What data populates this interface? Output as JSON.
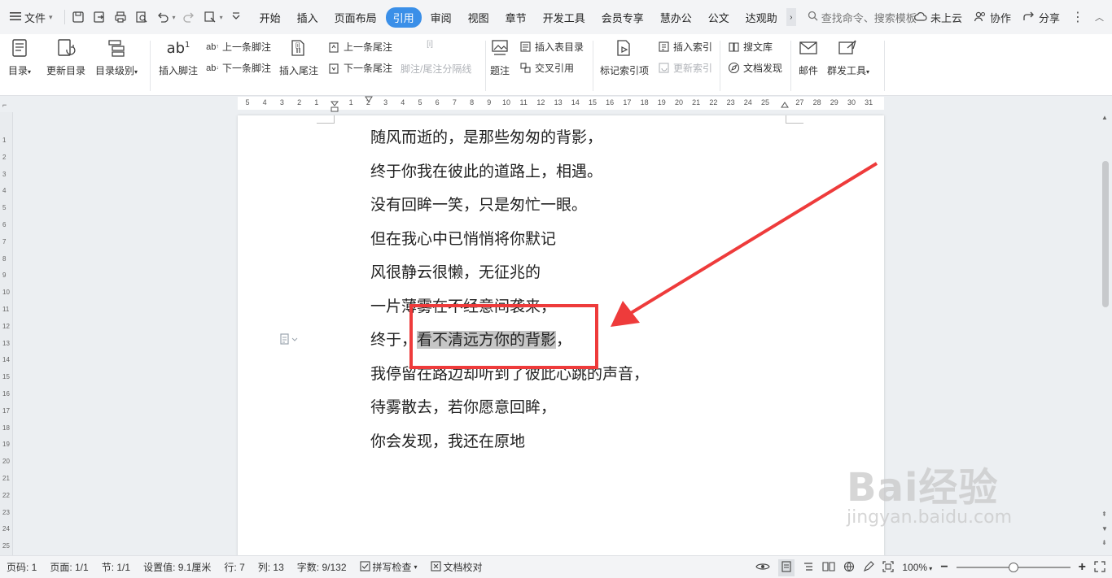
{
  "menubar": {
    "file_label": "文件",
    "tabs": [
      "开始",
      "插入",
      "页面布局",
      "引用",
      "审阅",
      "视图",
      "章节",
      "开发工具",
      "会员专享",
      "慧办公",
      "公文",
      "达观助"
    ],
    "active_tab": "引用",
    "search_placeholder": "查找命令、搜索模板",
    "right": {
      "cloud": "未上云",
      "collab": "协作",
      "share": "分享"
    }
  },
  "ribbon": {
    "toc": "目录",
    "update_toc": "更新目录",
    "toc_level": "目录级别",
    "insert_footnote": "插入脚注",
    "prev_footnote": "上一条脚注",
    "next_footnote": "下一条脚注",
    "insert_endnote": "插入尾注",
    "prev_endnote": "上一条尾注",
    "next_endnote": "下一条尾注",
    "note_separator": "脚注/尾注分隔线",
    "caption": "题注",
    "insert_table_toc": "插入表目录",
    "cross_ref": "交叉引用",
    "mark_index": "标记索引项",
    "insert_index": "插入索引",
    "update_index": "更新索引",
    "search_library": "搜文库",
    "doc_discover": "文档发现",
    "mail": "邮件",
    "mass_tool": "群发工具"
  },
  "ruler_numbers": [
    "5",
    "4",
    "3",
    "2",
    "1",
    "",
    "1",
    "2",
    "3",
    "4",
    "5",
    "6",
    "7",
    "8",
    "9",
    "10",
    "11",
    "12",
    "13",
    "14",
    "15",
    "16",
    "17",
    "18",
    "19",
    "20",
    "21",
    "22",
    "23",
    "24",
    "25",
    "",
    "27",
    "28",
    "29",
    "30",
    "31"
  ],
  "vruler_numbers": [
    "1",
    "2",
    "3",
    "4",
    "5",
    "6",
    "7",
    "8",
    "9",
    "10",
    "11",
    "12",
    "13",
    "14",
    "15",
    "16",
    "17",
    "18",
    "19",
    "20",
    "21",
    "22",
    "23",
    "24",
    "25"
  ],
  "document": {
    "lines": [
      "随风而逝的，是那些匆匆的背影，",
      "终于你我在彼此的道路上，相遇。",
      "没有回眸一笑，只是匆忙一眼。",
      "但在我心中已悄悄将你默记",
      "风很静云很懒，无征兆的",
      "一片薄雾在不经意间袭来，"
    ],
    "line7_prefix": "终于，",
    "line7_selected": "看不清远方你的背影",
    "line7_suffix": "，",
    "lines_after": [
      "我停留在路边却听到了彼此心跳的声音，",
      "待雾散去，若你愿意回眸，",
      "你会发现，我还在原地"
    ]
  },
  "watermark": {
    "brand": "Bai经验",
    "url": "jingyan.baidu.com"
  },
  "statusbar": {
    "page_num": "页码: 1",
    "pages": "页面: 1/1",
    "section": "节: 1/1",
    "setting": "设置值: 9.1厘米",
    "row": "行: 7",
    "col": "列: 13",
    "word_count": "字数: 9/132",
    "spell_check": "拼写检查",
    "doc_proof": "文档校对",
    "zoom": "100%"
  },
  "colors": {
    "accent": "#3a8fe8",
    "annotation": "#ee3b3b",
    "selection": "#c6c6c6"
  }
}
